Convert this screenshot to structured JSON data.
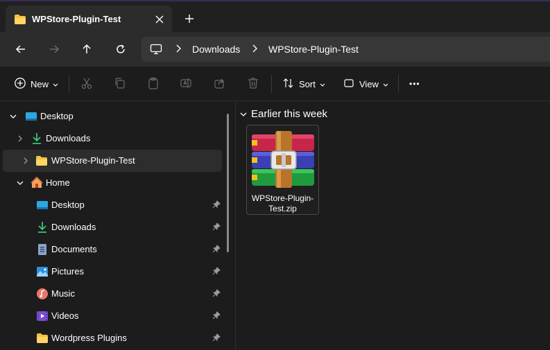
{
  "window": {
    "tab_title": "WPStore-Plugin-Test",
    "tab_close_icon": "close-icon",
    "new_tab_icon": "plus-icon"
  },
  "navigation": {
    "back_icon": "arrow-left-icon",
    "forward_icon": "arrow-right-icon",
    "up_icon": "arrow-up-icon",
    "refresh_icon": "refresh-icon",
    "breadcrumbs": [
      "Downloads",
      "WPStore-Plugin-Test"
    ],
    "separator": "›"
  },
  "toolbar": {
    "new_label": "New",
    "sort_label": "Sort",
    "view_label": "View",
    "more_label": "•••",
    "disabled_actions": [
      "cut",
      "copy",
      "paste",
      "rename",
      "share",
      "delete"
    ]
  },
  "sidebar": {
    "items": [
      {
        "label": "Desktop",
        "icon": "desktop-icon",
        "expanded": true
      },
      {
        "label": "Downloads",
        "icon": "download-icon"
      },
      {
        "label": "WPStore-Plugin-Test",
        "icon": "folder-icon",
        "selected": true
      },
      {
        "label": "Home",
        "icon": "home-icon",
        "expanded": true
      },
      {
        "label": "Desktop",
        "icon": "desktop-icon",
        "pinned": true
      },
      {
        "label": "Downloads",
        "icon": "download-icon",
        "pinned": true
      },
      {
        "label": "Documents",
        "icon": "documents-icon",
        "pinned": true
      },
      {
        "label": "Pictures",
        "icon": "pictures-icon",
        "pinned": true
      },
      {
        "label": "Music",
        "icon": "music-icon",
        "pinned": true
      },
      {
        "label": "Videos",
        "icon": "videos-icon",
        "pinned": true
      },
      {
        "label": "Wordpress Plugins",
        "icon": "folder-icon",
        "pinned": true
      }
    ]
  },
  "content": {
    "group_label": "Earlier this week",
    "files": [
      {
        "name_line1": "WPStore-Plugin-",
        "name_line2": "Test.zip",
        "icon": "winrar-archive-icon"
      }
    ]
  },
  "colors": {
    "background": "#1c1c1c",
    "folder": "#f5c342",
    "accent_download": "#3cc47c"
  }
}
